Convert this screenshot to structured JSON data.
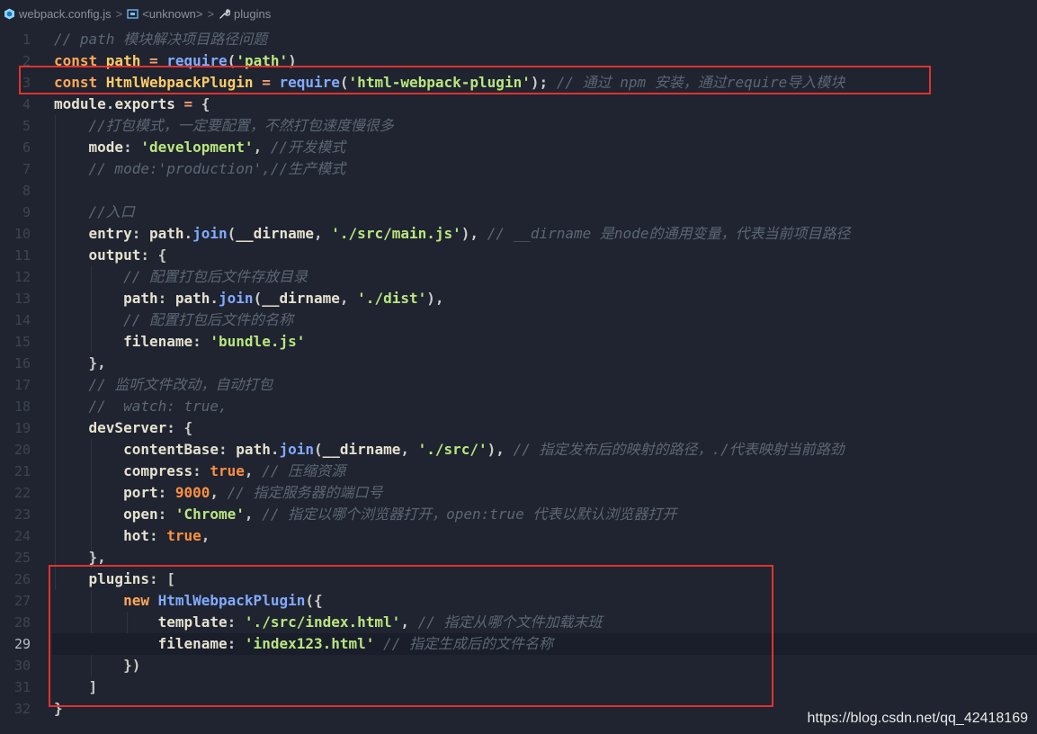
{
  "breadcrumb": {
    "file": "webpack.config.js",
    "symbol": "<unknown>",
    "section": "plugins",
    "separator": ">"
  },
  "editor": {
    "active_line": 29,
    "lines": [
      {
        "n": "1",
        "t": [
          [
            "cm",
            "// path 模块解决项目路径问题"
          ]
        ]
      },
      {
        "n": "2",
        "t": [
          [
            "kw",
            "const "
          ],
          [
            "id",
            "path"
          ],
          [
            "op",
            " = "
          ],
          [
            "fn",
            "require"
          ],
          [
            "pun",
            "("
          ],
          [
            "str",
            "'path'"
          ],
          [
            "pun",
            ")"
          ]
        ]
      },
      {
        "n": "3",
        "t": [
          [
            "kw",
            "const "
          ],
          [
            "id",
            "HtmlWebpackPlugin"
          ],
          [
            "op",
            " = "
          ],
          [
            "fn",
            "require"
          ],
          [
            "pun",
            "("
          ],
          [
            "str",
            "'html-webpack-plugin'"
          ],
          [
            "pun",
            ");"
          ],
          [
            "cm",
            " // 通过 npm 安装，通过require导入模块"
          ]
        ]
      },
      {
        "n": "4",
        "t": [
          [
            "prop",
            "module"
          ],
          [
            "pun",
            "."
          ],
          [
            "prop",
            "exports"
          ],
          [
            "op",
            " = "
          ],
          [
            "pun",
            "{"
          ]
        ]
      },
      {
        "n": "5",
        "t": [
          [
            "dim",
            "    "
          ],
          [
            "cm",
            "//打包模式，一定要配置，不然打包速度慢很多"
          ]
        ]
      },
      {
        "n": "6",
        "t": [
          [
            "dim",
            "    "
          ],
          [
            "prop",
            "mode"
          ],
          [
            "pun",
            ": "
          ],
          [
            "str",
            "'development'"
          ],
          [
            "pun",
            ", "
          ],
          [
            "cm",
            "//开发模式"
          ]
        ]
      },
      {
        "n": "7",
        "t": [
          [
            "dim",
            "    "
          ],
          [
            "cm",
            "// mode:'production',//生产模式"
          ]
        ]
      },
      {
        "n": "8",
        "t": []
      },
      {
        "n": "9",
        "t": [
          [
            "dim",
            "    "
          ],
          [
            "cm",
            "//入口"
          ]
        ]
      },
      {
        "n": "10",
        "t": [
          [
            "dim",
            "    "
          ],
          [
            "prop",
            "entry"
          ],
          [
            "pun",
            ": "
          ],
          [
            "prop",
            "path"
          ],
          [
            "pun",
            "."
          ],
          [
            "fn",
            "join"
          ],
          [
            "pun",
            "("
          ],
          [
            "prop",
            "__dirname"
          ],
          [
            "pun",
            ", "
          ],
          [
            "str",
            "'./src/main.js'"
          ],
          [
            "pun",
            "), "
          ],
          [
            "cm",
            "// __dirname 是node的通用变量，代表当前项目路径"
          ]
        ]
      },
      {
        "n": "11",
        "t": [
          [
            "dim",
            "    "
          ],
          [
            "prop",
            "output"
          ],
          [
            "pun",
            ": {"
          ]
        ]
      },
      {
        "n": "12",
        "t": [
          [
            "dim",
            "        "
          ],
          [
            "cm",
            "// 配置打包后文件存放目录"
          ]
        ]
      },
      {
        "n": "13",
        "t": [
          [
            "dim",
            "        "
          ],
          [
            "prop",
            "path"
          ],
          [
            "pun",
            ": "
          ],
          [
            "prop",
            "path"
          ],
          [
            "pun",
            "."
          ],
          [
            "fn",
            "join"
          ],
          [
            "pun",
            "("
          ],
          [
            "prop",
            "__dirname"
          ],
          [
            "pun",
            ", "
          ],
          [
            "str",
            "'./dist'"
          ],
          [
            "pun",
            "),"
          ]
        ]
      },
      {
        "n": "14",
        "t": [
          [
            "dim",
            "        "
          ],
          [
            "cm",
            "// 配置打包后文件的名称"
          ]
        ]
      },
      {
        "n": "15",
        "t": [
          [
            "dim",
            "        "
          ],
          [
            "prop",
            "filename"
          ],
          [
            "pun",
            ": "
          ],
          [
            "str",
            "'bundle.js'"
          ]
        ]
      },
      {
        "n": "16",
        "t": [
          [
            "dim",
            "    "
          ],
          [
            "pun",
            "},"
          ]
        ]
      },
      {
        "n": "17",
        "t": [
          [
            "dim",
            "    "
          ],
          [
            "cm",
            "// 监听文件改动，自动打包"
          ]
        ]
      },
      {
        "n": "18",
        "t": [
          [
            "dim",
            "    "
          ],
          [
            "cm",
            "//  watch: true,"
          ]
        ]
      },
      {
        "n": "19",
        "t": [
          [
            "dim",
            "    "
          ],
          [
            "prop",
            "devServer"
          ],
          [
            "pun",
            ": {"
          ]
        ]
      },
      {
        "n": "20",
        "t": [
          [
            "dim",
            "        "
          ],
          [
            "prop",
            "contentBase"
          ],
          [
            "pun",
            ": "
          ],
          [
            "prop",
            "path"
          ],
          [
            "pun",
            "."
          ],
          [
            "fn",
            "join"
          ],
          [
            "pun",
            "("
          ],
          [
            "prop",
            "__dirname"
          ],
          [
            "pun",
            ", "
          ],
          [
            "str",
            "'./src/'"
          ],
          [
            "pun",
            "), "
          ],
          [
            "cm",
            "// 指定发布后的映射的路径，./代表映射当前路劲"
          ]
        ]
      },
      {
        "n": "21",
        "t": [
          [
            "dim",
            "        "
          ],
          [
            "prop",
            "compress"
          ],
          [
            "pun",
            ": "
          ],
          [
            "bool",
            "true"
          ],
          [
            "pun",
            ", "
          ],
          [
            "cm",
            "// 压缩资源"
          ]
        ]
      },
      {
        "n": "22",
        "t": [
          [
            "dim",
            "        "
          ],
          [
            "prop",
            "port"
          ],
          [
            "pun",
            ": "
          ],
          [
            "num",
            "9000"
          ],
          [
            "pun",
            ", "
          ],
          [
            "cm",
            "// 指定服务器的端口号"
          ]
        ]
      },
      {
        "n": "23",
        "t": [
          [
            "dim",
            "        "
          ],
          [
            "prop",
            "open"
          ],
          [
            "pun",
            ": "
          ],
          [
            "str",
            "'Chrome'"
          ],
          [
            "pun",
            ", "
          ],
          [
            "cm",
            "// 指定以哪个浏览器打开，open:true 代表以默认浏览器打开"
          ]
        ]
      },
      {
        "n": "24",
        "t": [
          [
            "dim",
            "        "
          ],
          [
            "prop",
            "hot"
          ],
          [
            "pun",
            ": "
          ],
          [
            "bool",
            "true"
          ],
          [
            "pun",
            ","
          ]
        ]
      },
      {
        "n": "25",
        "t": [
          [
            "dim",
            "    "
          ],
          [
            "pun",
            "},"
          ]
        ]
      },
      {
        "n": "26",
        "t": [
          [
            "dim",
            "    "
          ],
          [
            "prop",
            "plugins"
          ],
          [
            "pun",
            ": ["
          ]
        ]
      },
      {
        "n": "27",
        "t": [
          [
            "dim",
            "        "
          ],
          [
            "kw",
            "new "
          ],
          [
            "cls",
            "HtmlWebpackPlugin"
          ],
          [
            "pun",
            "({"
          ]
        ]
      },
      {
        "n": "28",
        "t": [
          [
            "dim",
            "            "
          ],
          [
            "prop",
            "template"
          ],
          [
            "pun",
            ": "
          ],
          [
            "str",
            "'./src/index.html'"
          ],
          [
            "pun",
            ", "
          ],
          [
            "cm",
            "// 指定从哪个文件加载末班"
          ]
        ]
      },
      {
        "n": "29",
        "t": [
          [
            "dim",
            "            "
          ],
          [
            "prop",
            "filename"
          ],
          [
            "pun",
            ": "
          ],
          [
            "str",
            "'index123.html'"
          ],
          [
            "cm",
            " // 指定生成后的文件名称"
          ]
        ]
      },
      {
        "n": "30",
        "t": [
          [
            "dim",
            "        "
          ],
          [
            "pun",
            "})"
          ]
        ]
      },
      {
        "n": "31",
        "t": [
          [
            "dim",
            "    "
          ],
          [
            "pun",
            "]"
          ]
        ]
      },
      {
        "n": "32",
        "t": [
          [
            "pun",
            "}"
          ]
        ]
      }
    ]
  },
  "watermark": "https://blog.csdn.net/qq_42418169",
  "colors": {
    "background": "#1f2430",
    "highlight_box": "#e0322f",
    "keyword": "#ffa759",
    "function": "#82aaff",
    "string": "#bae67e",
    "comment": "#5c6773"
  }
}
